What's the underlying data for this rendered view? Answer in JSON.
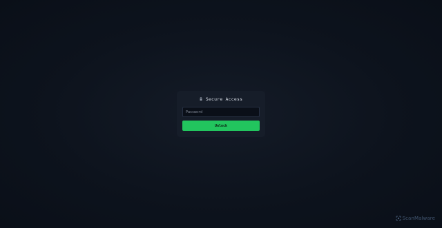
{
  "login": {
    "title": "Secure Access",
    "title_icon": "lock-icon",
    "password_placeholder": "Password",
    "password_value": "",
    "unlock_label": "Unlock"
  },
  "watermark": {
    "text": "ScanMalware",
    "icon": "scanmalware-logo-icon"
  },
  "colors": {
    "background": "#0d131d",
    "card": "#161d29",
    "input_bg": "#0a0f18",
    "accent": "#22c55e"
  }
}
